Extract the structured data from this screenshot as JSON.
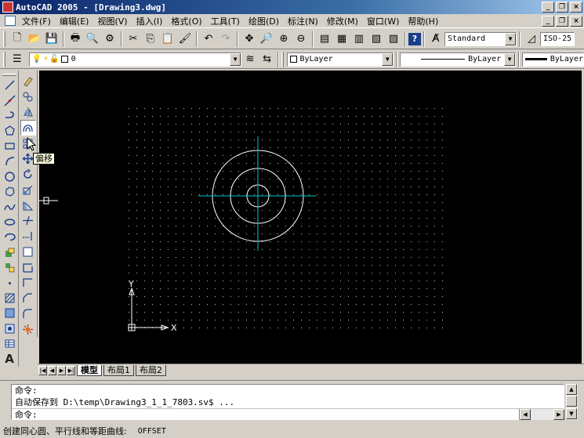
{
  "titlebar": {
    "title": "AutoCAD 2005 - [Drawing3.dwg]",
    "minimize": "_",
    "restore": "❐",
    "close": "×"
  },
  "menubar": {
    "items": [
      "文件(F)",
      "编辑(E)",
      "视图(V)",
      "插入(I)",
      "格式(O)",
      "工具(T)",
      "绘图(D)",
      "标注(N)",
      "修改(M)",
      "窗口(W)",
      "帮助(H)"
    ]
  },
  "toolbar": {
    "text_style": "Standard",
    "dim_style": "ISO-25"
  },
  "layers": {
    "current_layer": "0",
    "color": "ByLayer",
    "linetype": "ByLayer",
    "lineweight": "ByLayer"
  },
  "tooltip": {
    "text": "偏移"
  },
  "draw_tools": [
    "line-icon",
    "construction-line-icon",
    "polyline-icon",
    "polygon-icon",
    "rectangle-icon",
    "arc-icon",
    "circle-icon",
    "revcloud-icon",
    "spline-icon",
    "ellipse-icon",
    "ellipse-arc-icon",
    "insert-block-icon",
    "make-block-icon",
    "point-icon",
    "hatch-icon",
    "gradient-icon",
    "region-icon",
    "table-icon",
    "mtext-icon"
  ],
  "modify_tools": [
    "erase-icon",
    "copy-icon",
    "mirror-icon",
    "offset-icon",
    "array-icon",
    "move-icon",
    "rotate-icon",
    "scale-icon",
    "stretch-icon",
    "trim-icon",
    "extend-icon",
    "break-at-point-icon",
    "break-icon",
    "join-icon",
    "chamfer-icon",
    "fillet-icon",
    "explode-icon"
  ],
  "canvas": {
    "ucs_x_label": "X",
    "ucs_y_label": "Y",
    "background": "#000000",
    "grid_color": "#c0c0c0",
    "circle_color": "#ffffff",
    "centerline_color": "#00c8c8"
  },
  "layout_tabs": [
    "模型",
    "布局1",
    "布局2"
  ],
  "command": {
    "history": [
      "命令:",
      "自动保存到 D:\\temp\\Drawing3_1_1_7803.sv$ ..."
    ],
    "prompt": "命令:"
  },
  "status": {
    "description": "创建同心圆、平行线和等距曲线:",
    "command_name": "OFFSET"
  }
}
